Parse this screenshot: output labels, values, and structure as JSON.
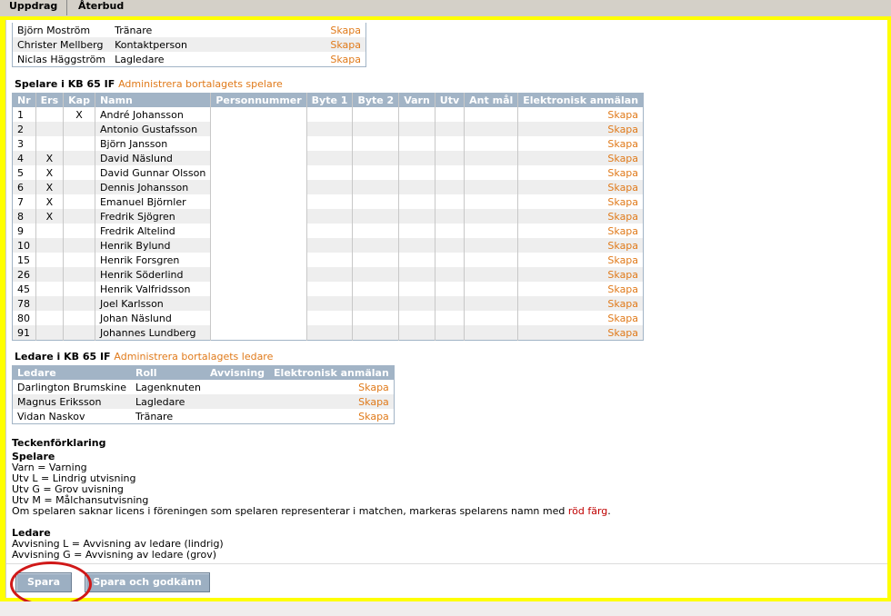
{
  "tabs": [
    "Uppdrag",
    "Återbud"
  ],
  "officials": [
    {
      "name": "Björn Moström",
      "role": "Tränare",
      "action": "Skapa"
    },
    {
      "name": "Christer Mellberg",
      "role": "Kontaktperson",
      "action": "Skapa"
    },
    {
      "name": "Niclas Häggström",
      "role": "Lagledare",
      "action": "Skapa"
    }
  ],
  "players_section": {
    "title": "Spelare i KB 65 IF",
    "admin_link": "Administrera bortalagets spelare"
  },
  "players_headers": [
    "Nr",
    "Ers",
    "Kap",
    "Namn",
    "Personnummer",
    "Byte 1",
    "Byte 2",
    "Varn",
    "Utv",
    "Ant mål",
    "Elektronisk anmälan"
  ],
  "players": [
    {
      "nr": "1",
      "ers": "",
      "kap": "X",
      "name": "André Johansson",
      "action": "Skapa"
    },
    {
      "nr": "2",
      "ers": "",
      "kap": "",
      "name": "Antonio Gustafsson",
      "action": "Skapa"
    },
    {
      "nr": "3",
      "ers": "",
      "kap": "",
      "name": "Björn Jansson",
      "action": "Skapa"
    },
    {
      "nr": "4",
      "ers": "X",
      "kap": "",
      "name": "David Näslund",
      "action": "Skapa"
    },
    {
      "nr": "5",
      "ers": "X",
      "kap": "",
      "name": "David Gunnar Olsson",
      "action": "Skapa"
    },
    {
      "nr": "6",
      "ers": "X",
      "kap": "",
      "name": "Dennis Johansson",
      "action": "Skapa"
    },
    {
      "nr": "7",
      "ers": "X",
      "kap": "",
      "name": "Emanuel Björnler",
      "action": "Skapa"
    },
    {
      "nr": "8",
      "ers": "X",
      "kap": "",
      "name": "Fredrik Sjögren",
      "action": "Skapa"
    },
    {
      "nr": "9",
      "ers": "",
      "kap": "",
      "name": "Fredrik Altelind",
      "action": "Skapa"
    },
    {
      "nr": "10",
      "ers": "",
      "kap": "",
      "name": "Henrik Bylund",
      "action": "Skapa"
    },
    {
      "nr": "15",
      "ers": "",
      "kap": "",
      "name": "Henrik Forsgren",
      "action": "Skapa"
    },
    {
      "nr": "26",
      "ers": "",
      "kap": "",
      "name": "Henrik Söderlind",
      "action": "Skapa"
    },
    {
      "nr": "45",
      "ers": "",
      "kap": "",
      "name": "Henrik Valfridsson",
      "action": "Skapa"
    },
    {
      "nr": "78",
      "ers": "",
      "kap": "",
      "name": "Joel Karlsson",
      "action": "Skapa"
    },
    {
      "nr": "80",
      "ers": "",
      "kap": "",
      "name": "Johan Näslund",
      "action": "Skapa"
    },
    {
      "nr": "91",
      "ers": "",
      "kap": "",
      "name": "Johannes Lundberg",
      "action": "Skapa"
    }
  ],
  "leaders_section": {
    "title": "Ledare i KB 65 IF",
    "admin_link": "Administrera bortalagets ledare"
  },
  "leaders_headers": [
    "Ledare",
    "Roll",
    "Avvisning",
    "Elektronisk anmälan"
  ],
  "leaders": [
    {
      "name": "Darlington Brumskine",
      "role": "Lagenknuten",
      "action": "Skapa"
    },
    {
      "name": "Magnus Eriksson",
      "role": "Lagledare",
      "action": "Skapa"
    },
    {
      "name": "Vidan Naskov",
      "role": "Tränare",
      "action": "Skapa"
    }
  ],
  "legend": {
    "title": "Teckenförklaring",
    "players_title": "Spelare",
    "players_lines": [
      "Varn = Varning",
      "Utv L = Lindrig utvisning",
      "Utv G = Grov uvisning",
      "Utv M = Målchansutvisning"
    ],
    "license_note_pre": "Om spelaren saknar licens i föreningen som spelaren representerar i matchen, markeras spelarens namn med ",
    "license_note_red": "röd färg",
    "license_note_post": ".",
    "leaders_title": "Ledare",
    "leaders_lines": [
      "Avvisning L =  Avvisning av ledare (lindrig)",
      "Avvisning G =  Avvisning av ledare (grov)"
    ]
  },
  "buttons": {
    "save": "Spara",
    "save_approve": "Spara och godkänn"
  }
}
